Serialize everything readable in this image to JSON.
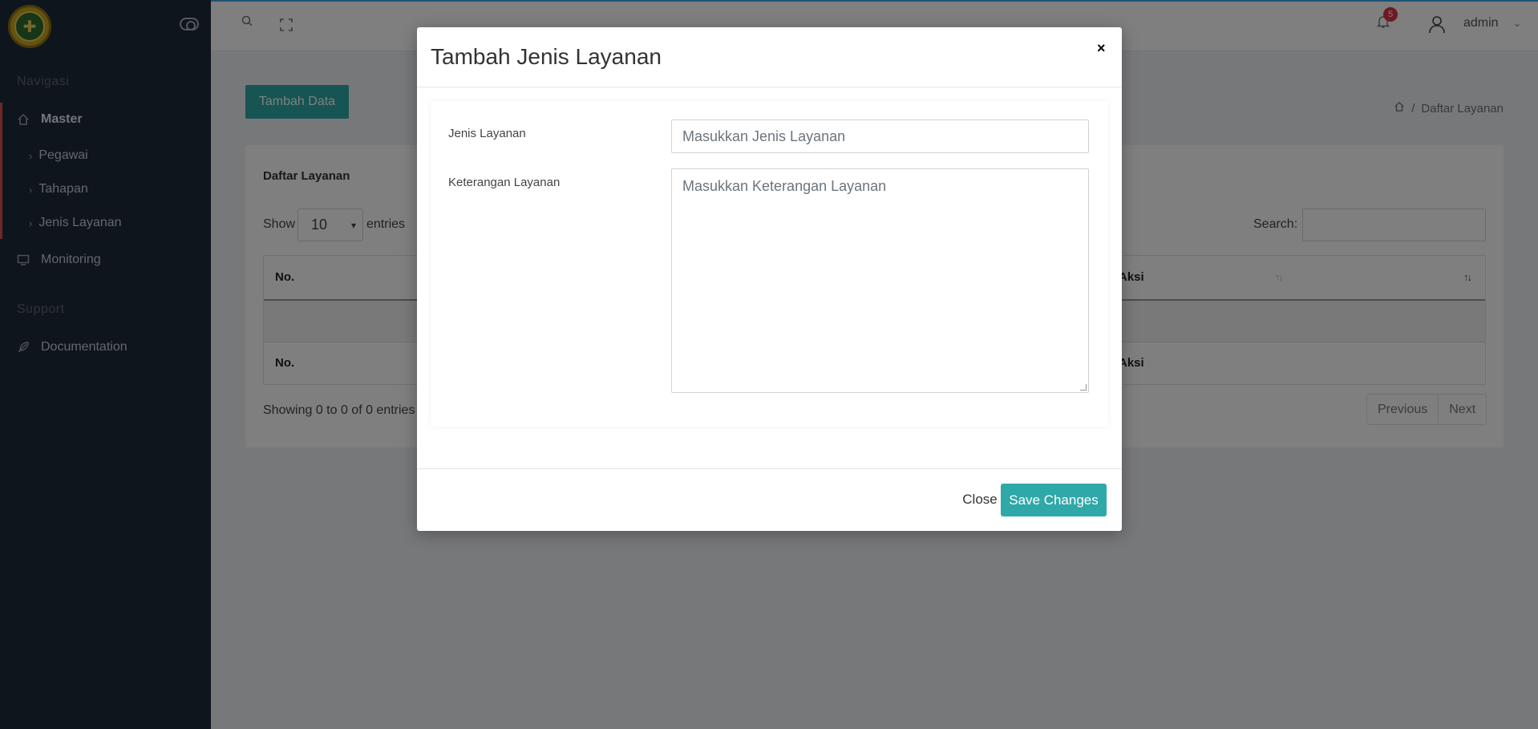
{
  "sidebar": {
    "heading_nav": "Navigasi",
    "master": "Master",
    "sub_items": [
      "Pegawai",
      "Tahapan",
      "Jenis Layanan"
    ],
    "monitoring": "Monitoring",
    "heading_support": "Support",
    "documentation": "Documentation"
  },
  "topbar": {
    "notification_count": "5",
    "user": "admin"
  },
  "page": {
    "add_button": "Tambah Data",
    "breadcrumb": "Daftar Layanan",
    "card_title": "Daftar Layanan",
    "show_label": "Show",
    "entries_value": "10",
    "entries_label": "entries",
    "search_label": "Search:",
    "columns": [
      "No.",
      "Aksi"
    ],
    "info": "Showing 0 to 0 of 0 entries",
    "previous": "Previous",
    "next": "Next"
  },
  "modal": {
    "title": "Tambah Jenis Layanan",
    "close_x": "×",
    "label_jenis": "Jenis Layanan",
    "placeholder_jenis": "Masukkan Jenis Layanan",
    "label_keterangan": "Keterangan Layanan",
    "placeholder_keterangan": "Masukkan Keterangan Layanan",
    "close_button": "Close",
    "save_button": "Save Changes"
  },
  "colors": {
    "accent": "#2fa8a8",
    "sidebar_bg": "#1f2a3a",
    "badge": "#dc3545"
  }
}
